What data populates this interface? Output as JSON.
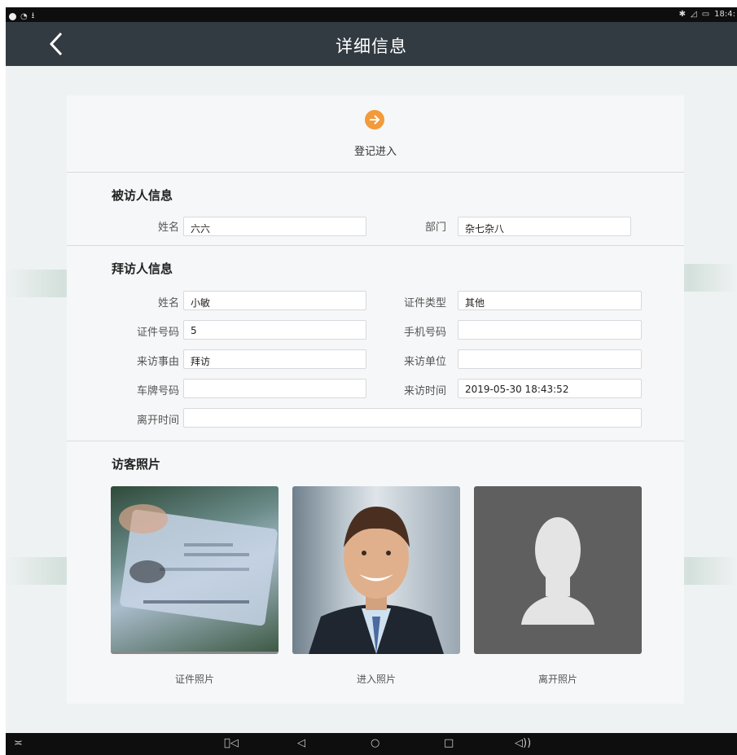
{
  "statusbar": {
    "time": "18:4:"
  },
  "header": {
    "title": "详细信息"
  },
  "action": {
    "label": "登记进入"
  },
  "visitee": {
    "title": "被访人信息",
    "name_label": "姓名",
    "name_value": "六六",
    "dept_label": "部门",
    "dept_value": "杂七杂八"
  },
  "visitor": {
    "title": "拜访人信息",
    "fields": [
      {
        "label": "姓名",
        "value": "小敏"
      },
      {
        "label": "证件类型",
        "value": "其他"
      },
      {
        "label": "证件号码",
        "value": "5"
      },
      {
        "label": "手机号码",
        "value": ""
      },
      {
        "label": "来访事由",
        "value": "拜访"
      },
      {
        "label": "来访单位",
        "value": ""
      },
      {
        "label": "车牌号码",
        "value": ""
      },
      {
        "label": "来访时间",
        "value": "2019-05-30 18:43:52"
      },
      {
        "label": "离开时间",
        "value": ""
      }
    ]
  },
  "photos": {
    "title": "访客照片",
    "items": [
      {
        "caption": "证件照片"
      },
      {
        "caption": "进入照片"
      },
      {
        "caption": "离开照片"
      }
    ]
  },
  "colors": {
    "accent": "#f39a3a",
    "titlebar": "#333b42"
  }
}
